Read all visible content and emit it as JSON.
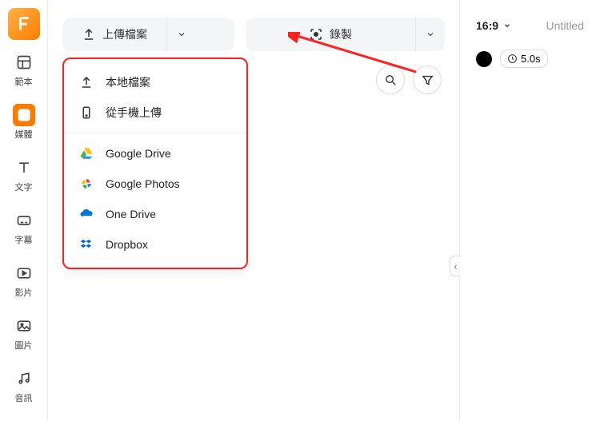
{
  "sidebar": {
    "items": [
      {
        "label": "範本"
      },
      {
        "label": "媒體"
      },
      {
        "label": "文字"
      },
      {
        "label": "字幕"
      },
      {
        "label": "影片"
      },
      {
        "label": "圖片"
      },
      {
        "label": "音訊"
      }
    ]
  },
  "toolbar": {
    "upload_label": "上傳檔案",
    "record_label": "錄製"
  },
  "dropdown": {
    "local": "本地檔案",
    "mobile": "從手機上傳",
    "gdrive": "Google Drive",
    "gphotos": "Google Photos",
    "onedrive": "One Drive",
    "dropbox": "Dropbox"
  },
  "right_panel": {
    "aspect": "16:9",
    "title": "Untitled",
    "duration": "5.0s"
  }
}
